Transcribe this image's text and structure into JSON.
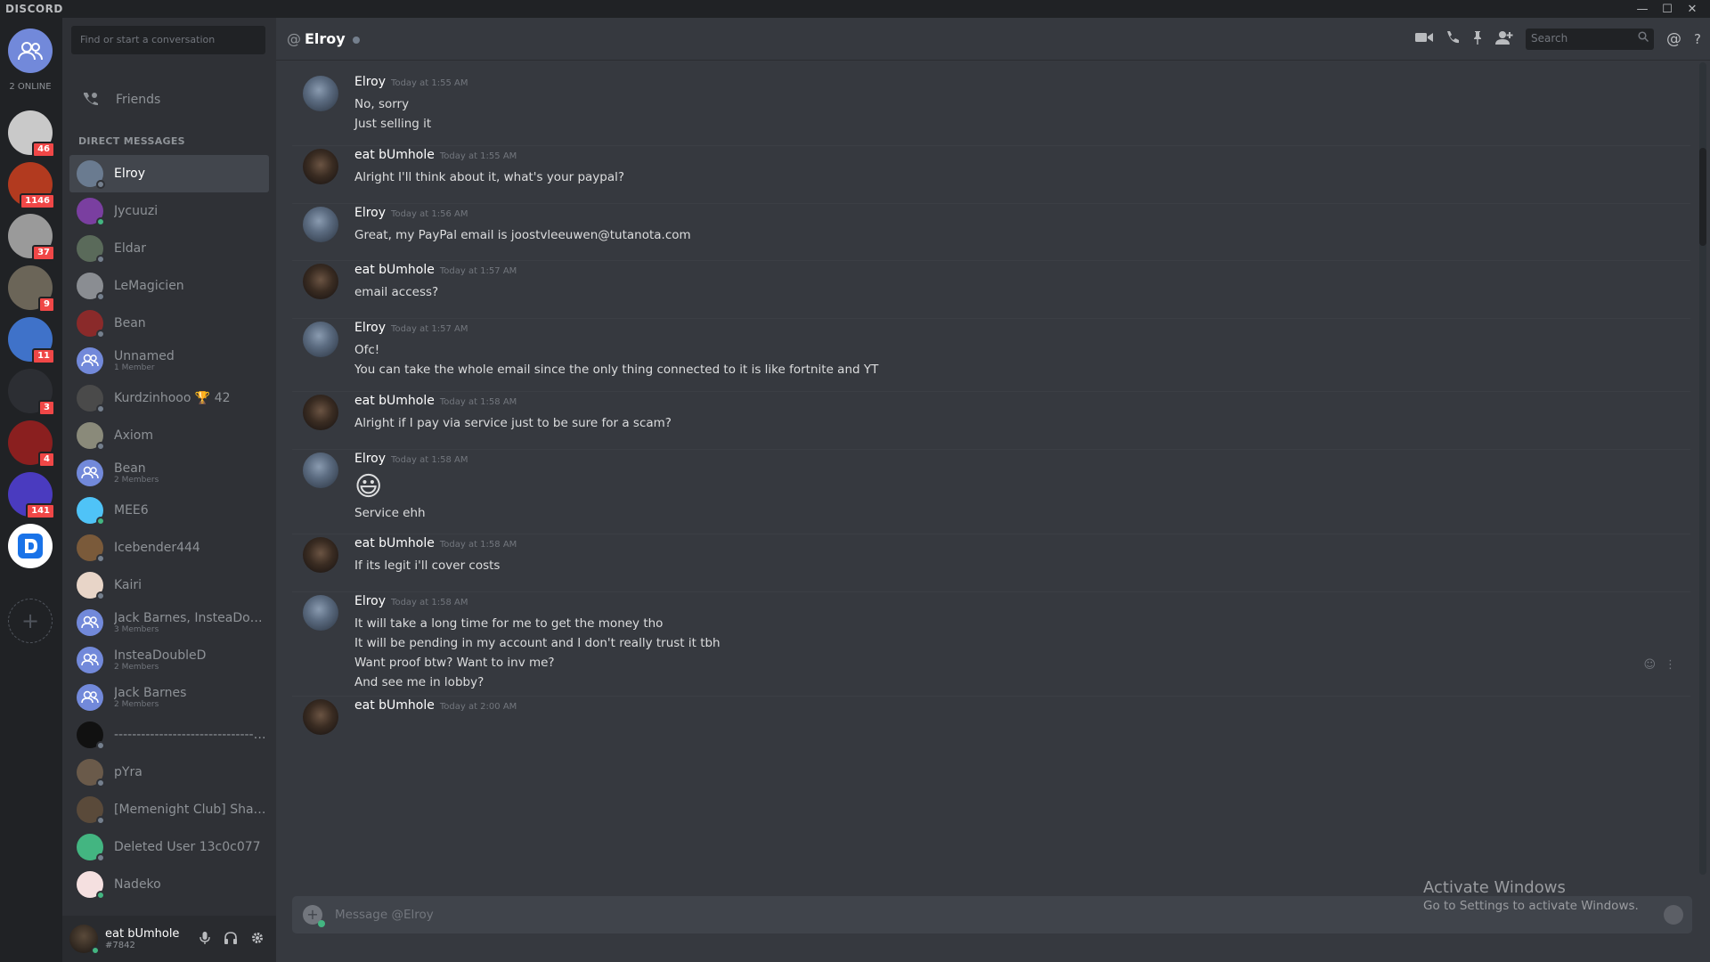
{
  "app": {
    "logo": "DISCORD",
    "window_buttons": [
      "—",
      "☐",
      "✕"
    ]
  },
  "guilds": {
    "online_label": "2 ONLINE",
    "items": [
      {
        "name": "say-no-to-soy",
        "badge": "46",
        "color": "#c9c9c9"
      },
      {
        "name": "guild-red-face",
        "badge": "1146",
        "color": "#b23a1f"
      },
      {
        "name": "guild-photo",
        "badge": "37",
        "color": "#9a9a9a"
      },
      {
        "name": "guild-people",
        "badge": "9",
        "color": "#6b6558"
      },
      {
        "name": "guild-shoe",
        "badge": "11",
        "color": "#3f72c9"
      },
      {
        "name": "guild-dark",
        "badge": "3",
        "color": "#2c2e33"
      },
      {
        "name": "guild-red-logo",
        "badge": "4",
        "color": "#8a1f1f"
      },
      {
        "name": "guild-purple",
        "badge": "141",
        "color": "#4a3bbf"
      },
      {
        "name": "guild-d",
        "badge": "",
        "color": "#ffffff"
      }
    ],
    "add_label": "+"
  },
  "dm": {
    "search_placeholder": "Find or start a conversation",
    "friends_label": "Friends",
    "header": "DIRECT MESSAGES",
    "items": [
      {
        "name": "Elroy",
        "sub": "",
        "color": "#6a7b90",
        "status": "off",
        "active": true
      },
      {
        "name": "Jycuuzi",
        "sub": "",
        "color": "#7a3fa0",
        "status": "on"
      },
      {
        "name": "Eldar",
        "sub": "",
        "color": "#5a6a5a",
        "status": "off"
      },
      {
        "name": "LeMagicien",
        "sub": "",
        "color": "#8a8d92",
        "status": "off"
      },
      {
        "name": "Bean",
        "sub": "",
        "color": "#8a2a2a",
        "status": "off"
      },
      {
        "name": "Unnamed",
        "sub": "1 Member",
        "color": "#7289da",
        "status": ""
      },
      {
        "name": "Kurdzinhooo 🏆 42",
        "sub": "",
        "color": "#4a4a4a",
        "status": "off"
      },
      {
        "name": "Axiom",
        "sub": "",
        "color": "#8a8a7a",
        "status": "off"
      },
      {
        "name": "Bean",
        "sub": "2 Members",
        "color": "#7289da",
        "status": ""
      },
      {
        "name": "MEE6",
        "sub": "",
        "color": "#4fc3f7",
        "status": "on"
      },
      {
        "name": "Icebender444",
        "sub": "",
        "color": "#7a5a3a",
        "status": "off"
      },
      {
        "name": "Kairi",
        "sub": "",
        "color": "#e8d5c8",
        "status": "off"
      },
      {
        "name": "Jack Barnes, InsteaDoub...",
        "sub": "3 Members",
        "color": "#7289da",
        "status": ""
      },
      {
        "name": "InsteaDoubleD",
        "sub": "2 Members",
        "color": "#7289da",
        "status": ""
      },
      {
        "name": "Jack Barnes",
        "sub": "2 Members",
        "color": "#7289da",
        "status": ""
      },
      {
        "name": "-----------------------------------",
        "sub": "",
        "color": "#111111",
        "status": "off"
      },
      {
        "name": "pYra",
        "sub": "",
        "color": "#6a5a4a",
        "status": "off"
      },
      {
        "name": "[Memenight Club] Shai ...",
        "sub": "",
        "color": "#5a4a3a",
        "status": "off"
      },
      {
        "name": "Deleted User 13c0c077",
        "sub": "",
        "color": "#43b581",
        "status": "off"
      },
      {
        "name": "Nadeko",
        "sub": "",
        "color": "#f5e0e0",
        "status": "on"
      }
    ]
  },
  "user": {
    "name": "eat bUmhole",
    "tag": "#7842"
  },
  "chat": {
    "recipient": "Elroy",
    "search_placeholder": "Search",
    "composer_placeholder": "Message @Elroy",
    "messages": [
      {
        "author": "Elroy",
        "time": "Today at 1:55 AM",
        "lines": [
          "No, sorry",
          "Just selling it"
        ]
      },
      {
        "author": "eat bUmhole",
        "time": "Today at 1:55 AM",
        "lines": [
          "Alright I'll think about it, what's your paypal?"
        ]
      },
      {
        "author": "Elroy",
        "time": "Today at 1:56 AM",
        "lines": [
          "Great, my PayPal email is joostvleeuwen@tutanota.com"
        ]
      },
      {
        "author": "eat bUmhole",
        "time": "Today at 1:57 AM",
        "lines": [
          "email access?"
        ]
      },
      {
        "author": "Elroy",
        "time": "Today at 1:57 AM",
        "lines": [
          "Ofc!",
          "You can take the whole email since the only thing connected to it is like fortnite and YT"
        ]
      },
      {
        "author": "eat bUmhole",
        "time": "Today at 1:58 AM",
        "lines": [
          "Alright if I pay via service just to be sure for a scam?"
        ]
      },
      {
        "author": "Elroy",
        "time": "Today at 1:58 AM",
        "emoji": "😃",
        "lines": [
          "Service ehh"
        ]
      },
      {
        "author": "eat bUmhole",
        "time": "Today at 1:58 AM",
        "lines": [
          "If its legit i'll cover costs"
        ]
      },
      {
        "author": "Elroy",
        "time": "Today at 1:58 AM",
        "lines": [
          "It will take a long time for me to get the money tho",
          "It will be pending in my account and I don't really trust it tbh",
          "Want proof btw? Want to inv me?",
          "And see me in lobby?"
        ]
      },
      {
        "author": "eat bUmhole",
        "time": "Today at 2:00 AM",
        "lines": []
      }
    ]
  },
  "watermark": {
    "title": "Activate Windows",
    "subtitle": "Go to Settings to activate Windows."
  }
}
